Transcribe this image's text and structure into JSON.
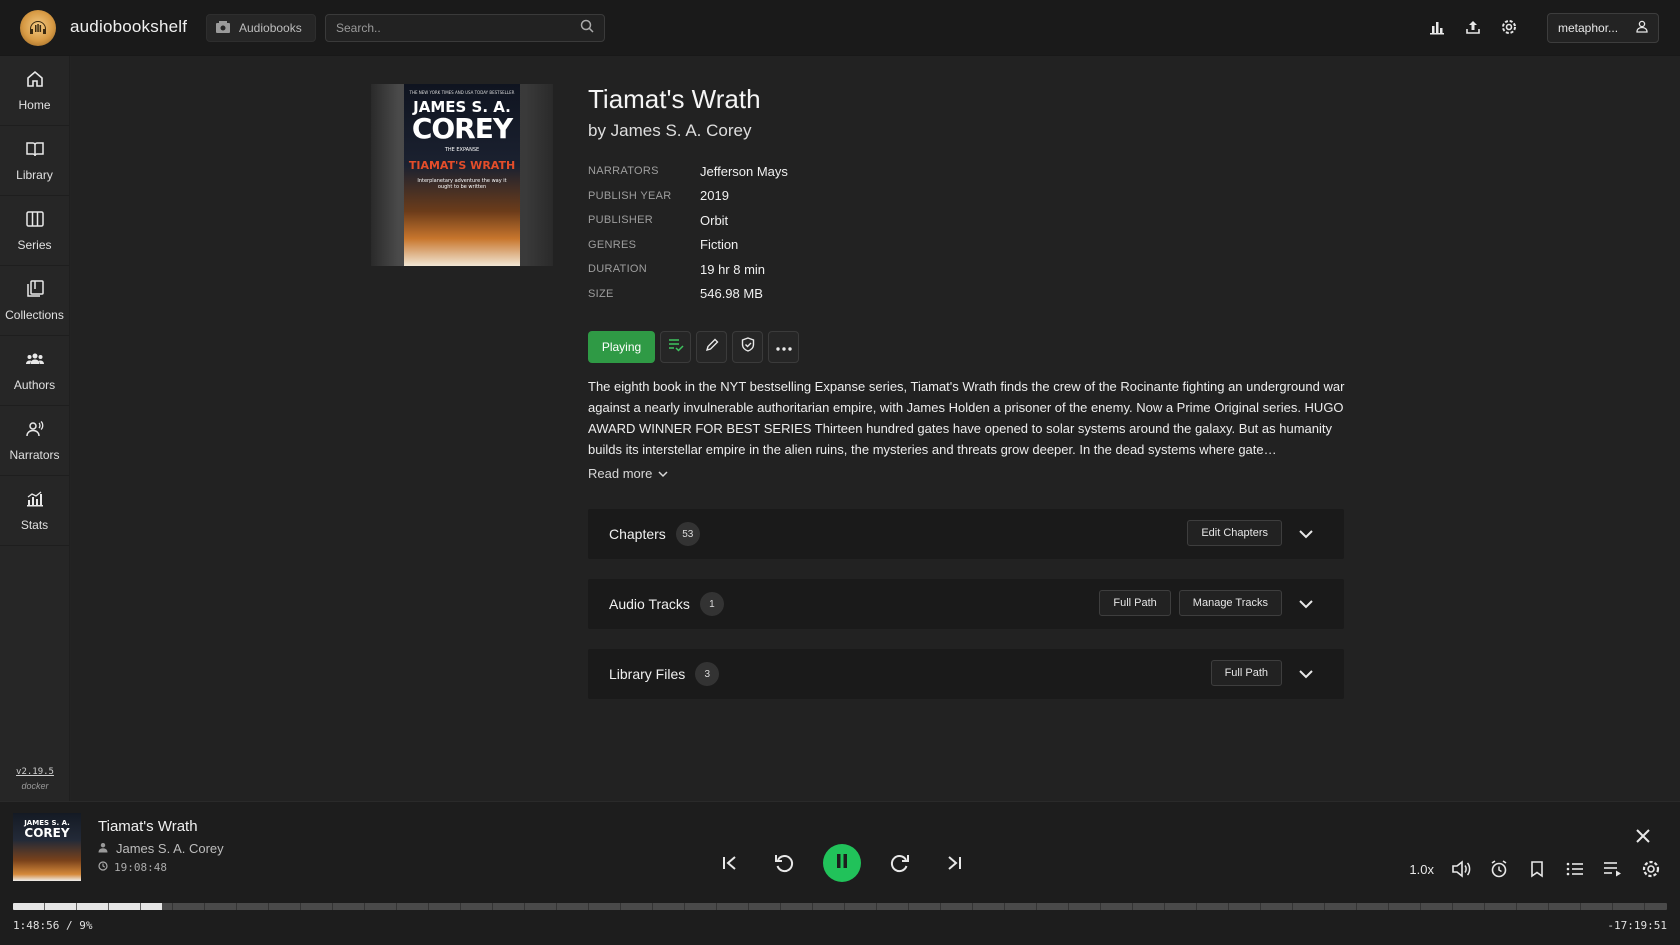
{
  "app": {
    "title": "audiobookshelf"
  },
  "library_select": {
    "label": "Audiobooks"
  },
  "search": {
    "placeholder": "Search.."
  },
  "user": {
    "name": "metaphor..."
  },
  "sidebar": {
    "items": [
      {
        "label": "Home",
        "icon": "home-icon"
      },
      {
        "label": "Library",
        "icon": "book-open-icon"
      },
      {
        "label": "Series",
        "icon": "columns-icon"
      },
      {
        "label": "Collections",
        "icon": "collections-icon"
      },
      {
        "label": "Authors",
        "icon": "users-icon"
      },
      {
        "label": "Narrators",
        "icon": "narrator-icon"
      },
      {
        "label": "Stats",
        "icon": "stats-icon"
      }
    ],
    "version": "v2.19.5",
    "install": "docker"
  },
  "book": {
    "title": "Tiamat's Wrath",
    "author_line": "by James S. A. Corey",
    "cover": {
      "tagline": "THE NEW YORK TIMES AND USA TODAY BESTSELLER",
      "author_first": "JAMES S. A.",
      "author_last": "COREY",
      "series": "THE EXPANSE",
      "title": "TIAMAT'S WRATH",
      "quote": "Interplanetary adventure the way it ought to be written"
    },
    "meta": [
      {
        "key": "NARRATORS",
        "value": "Jefferson Mays"
      },
      {
        "key": "PUBLISH YEAR",
        "value": "2019"
      },
      {
        "key": "PUBLISHER",
        "value": "Orbit"
      },
      {
        "key": "GENRES",
        "value": "Fiction"
      },
      {
        "key": "DURATION",
        "value": "19 hr 8 min"
      },
      {
        "key": "SIZE",
        "value": "546.98 MB"
      }
    ],
    "playing_label": "Playing",
    "description": "The eighth book in the NYT bestselling Expanse series, Tiamat's Wrath finds the crew of the Rocinante fighting an underground war against a nearly invulnerable authoritarian empire, with James Holden a prisoner of the enemy. Now a Prime Original series. HUGO AWARD WINNER FOR BEST SERIES Thirteen hundred gates have opened to solar systems around the galaxy. But as humanity builds its interstellar empire in the alien ruins, the mysteries and threats grow deeper. In the dead systems where gate…",
    "read_more": "Read more"
  },
  "panels": {
    "chapters": {
      "label": "Chapters",
      "count": "53",
      "edit": "Edit Chapters"
    },
    "audio_tracks": {
      "label": "Audio Tracks",
      "count": "1",
      "full_path": "Full Path",
      "manage": "Manage Tracks"
    },
    "library_files": {
      "label": "Library Files",
      "count": "3",
      "full_path": "Full Path"
    }
  },
  "player": {
    "title": "Tiamat's Wrath",
    "author": "James S. A. Corey",
    "duration": "19:08:48",
    "speed": "1.0x",
    "elapsed": "1:48:56 / 9%",
    "remaining": "-17:19:51",
    "progress_fraction": 0.09,
    "cover": {
      "author_first": "JAMES S. A.",
      "author_last": "COREY"
    }
  },
  "colors": {
    "accent_green": "#2f9a45",
    "play_green": "#21c25a"
  }
}
